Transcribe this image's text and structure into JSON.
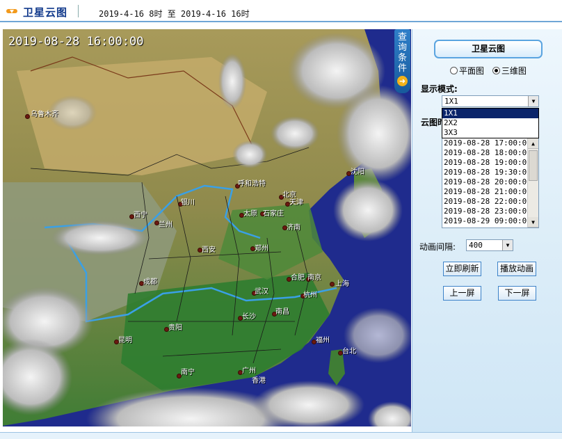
{
  "header": {
    "title": "卫星云图",
    "time_range": "2019-4-16 8时 至 2019-4-16 16时"
  },
  "map": {
    "timestamp": "2019-08-28 16:00:00",
    "cities": [
      {
        "name": "乌鲁木齐"
      },
      {
        "name": "沈阳"
      },
      {
        "name": "呼和浩特"
      },
      {
        "name": "北京"
      },
      {
        "name": "天津"
      },
      {
        "name": "银川"
      },
      {
        "name": "西宁"
      },
      {
        "name": "兰州"
      },
      {
        "name": "太原"
      },
      {
        "name": "石家庄"
      },
      {
        "name": "济南"
      },
      {
        "name": "西安"
      },
      {
        "name": "郑州"
      },
      {
        "name": "合肥"
      },
      {
        "name": "南京"
      },
      {
        "name": "上海"
      },
      {
        "name": "成都"
      },
      {
        "name": "武汉"
      },
      {
        "name": "杭州"
      },
      {
        "name": "长沙"
      },
      {
        "name": "南昌"
      },
      {
        "name": "贵阳"
      },
      {
        "name": "昆明"
      },
      {
        "name": "福州"
      },
      {
        "name": "台北"
      },
      {
        "name": "南宁"
      },
      {
        "name": "广州"
      },
      {
        "name": "香港"
      }
    ]
  },
  "query_tab": {
    "chars": [
      "查",
      "询",
      "条",
      "件"
    ]
  },
  "panel": {
    "title": "卫星云图",
    "radio_options": [
      {
        "label": "平面图",
        "checked": false
      },
      {
        "label": "三维图",
        "checked": true
      }
    ],
    "display_mode_label": "显示模式:",
    "display_mode_value": "1X1",
    "display_mode_options": [
      "1X1",
      "2X2",
      "3X3"
    ],
    "cloud_label": "云图时",
    "time_list": [
      "2019-08-28 17:00:00",
      "2019-08-28 18:00:00",
      "2019-08-28 19:00:00",
      "2019-08-28 19:30:00",
      "2019-08-28 20:00:00",
      "2019-08-28 21:00:00",
      "2019-08-28 22:00:00",
      "2019-08-28 23:00:00",
      "2019-08-29 09:00:00"
    ],
    "interval_label": "动画间隔:",
    "interval_value": "400",
    "buttons": {
      "refresh": "立即刷新",
      "play": "播放动画",
      "prev": "上一屏",
      "next": "下一屏"
    }
  },
  "colors": {
    "header_title": "#123a8c",
    "ocean": "#1e2a8a",
    "panel_border": "#5aa4e0",
    "selected_option": "#0a246a"
  }
}
